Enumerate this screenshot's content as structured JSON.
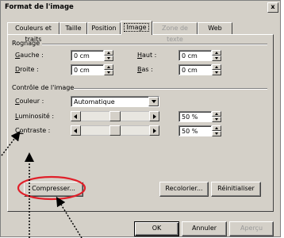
{
  "window": {
    "title": "Format de l'image",
    "close_glyph": "x"
  },
  "tabs": [
    {
      "label": "Couleurs et traits",
      "state": "normal"
    },
    {
      "label": "Taille",
      "state": "normal"
    },
    {
      "label": "Position",
      "state": "normal"
    },
    {
      "label": "Image",
      "state": "active"
    },
    {
      "label": "Zone de texte",
      "state": "disabled"
    },
    {
      "label": "Web",
      "state": "normal"
    }
  ],
  "crop": {
    "group_label": "Rognage",
    "left": {
      "label": "Gauche :",
      "accel": "G",
      "value": "0 cm"
    },
    "top": {
      "label": "Haut :",
      "accel": "H",
      "value": "0 cm"
    },
    "right": {
      "label": "Droite :",
      "accel": "D",
      "value": "0 cm"
    },
    "bottom": {
      "label": "Bas :",
      "accel": "B",
      "value": "0 cm"
    }
  },
  "image_control": {
    "group_label": "Contrôle de l'image",
    "color": {
      "label": "Couleur :",
      "accel": "C",
      "value": "Automatique"
    },
    "brightness": {
      "label": "Luminosité :",
      "accel": "L",
      "value": "50 %",
      "level": 0.5
    },
    "contrast": {
      "label": "Contraste :",
      "accel": "o",
      "value": "50 %",
      "level": 0.5
    }
  },
  "buttons": {
    "compress": "Compresser...",
    "recolor": "Recolorier...",
    "reset": "Réinitialiser",
    "ok": "OK",
    "cancel": "Annuler",
    "preview": "Aperçu"
  },
  "annotations": {
    "highlight_color": "#e0202a",
    "arrow_color": "#000000"
  }
}
